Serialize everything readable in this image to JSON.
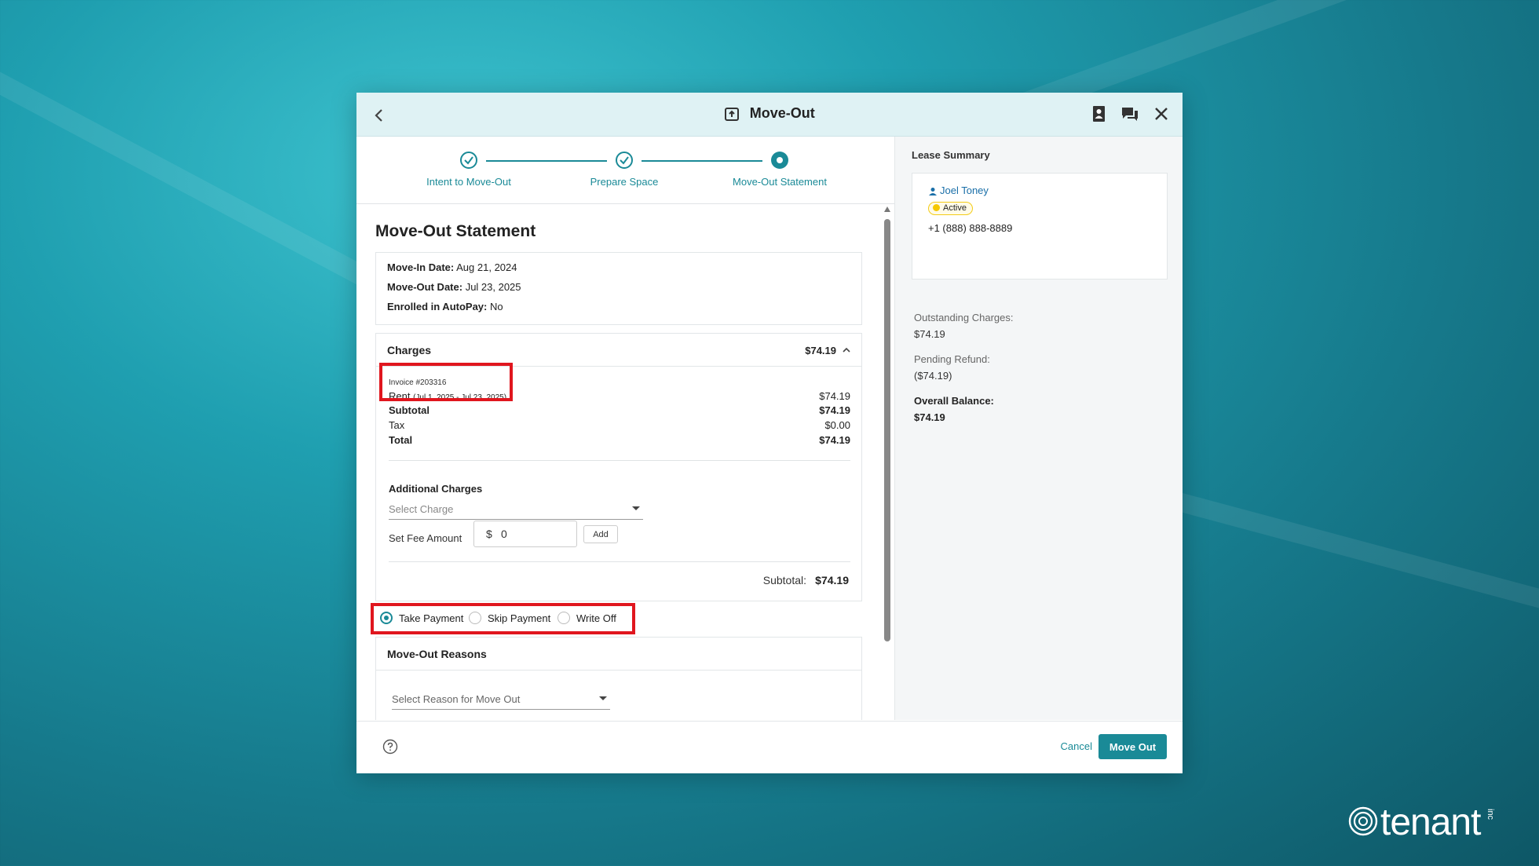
{
  "modal": {
    "title": "Move-Out"
  },
  "stepper": {
    "steps": [
      {
        "label": "Intent to Move-Out",
        "state": "done"
      },
      {
        "label": "Prepare Space",
        "state": "done"
      },
      {
        "label": "Move-Out Statement",
        "state": "current"
      }
    ]
  },
  "statement": {
    "title": "Move-Out Statement",
    "move_in": {
      "label": "Move-In Date:",
      "value": "Aug 21, 2024"
    },
    "move_out": {
      "label": "Move-Out Date:",
      "value": "Jul 23, 2025"
    },
    "autopay": {
      "label": "Enrolled in AutoPay:",
      "value": "No"
    }
  },
  "charges": {
    "title": "Charges",
    "header_total": "$74.19",
    "invoice_label": "Invoice #203316",
    "rent": {
      "label": "Rent",
      "period": "(Jul 1, 2025 - Jul 23, 2025)",
      "amount": "$74.19"
    },
    "subtotal": {
      "label": "Subtotal",
      "amount": "$74.19"
    },
    "tax": {
      "label": "Tax",
      "amount": "$0.00"
    },
    "total": {
      "label": "Total",
      "amount": "$74.19"
    },
    "additional_title": "Additional Charges",
    "select_placeholder": "Select Charge",
    "fee_label": "Set Fee Amount",
    "fee_currency": "$",
    "fee_value": "0",
    "add_label": "Add",
    "footer_subtotal_label": "Subtotal:",
    "footer_subtotal_value": "$74.19"
  },
  "payment_options": [
    {
      "label": "Take Payment",
      "selected": true
    },
    {
      "label": "Skip Payment",
      "selected": false
    },
    {
      "label": "Write Off",
      "selected": false
    }
  ],
  "reasons": {
    "title": "Move-Out Reasons",
    "select_placeholder": "Select Reason for Move Out"
  },
  "lease_summary": {
    "title": "Lease Summary",
    "tenant_name": "Joel Toney",
    "status": "Active",
    "phone": "+1 (888) 888-8889",
    "outstanding_label": "Outstanding Charges:",
    "outstanding_value": "$74.19",
    "pending_label": "Pending Refund:",
    "pending_value": "($74.19)",
    "overall_label": "Overall Balance:",
    "overall_value": "$74.19"
  },
  "footer": {
    "cancel_label": "Cancel",
    "moveout_label": "Move Out"
  },
  "brand": {
    "word": "tenant",
    "suffix": "inc"
  },
  "colors": {
    "accent": "#1a8a97",
    "highlight": "#e0161e",
    "badge": "#f5c800"
  }
}
